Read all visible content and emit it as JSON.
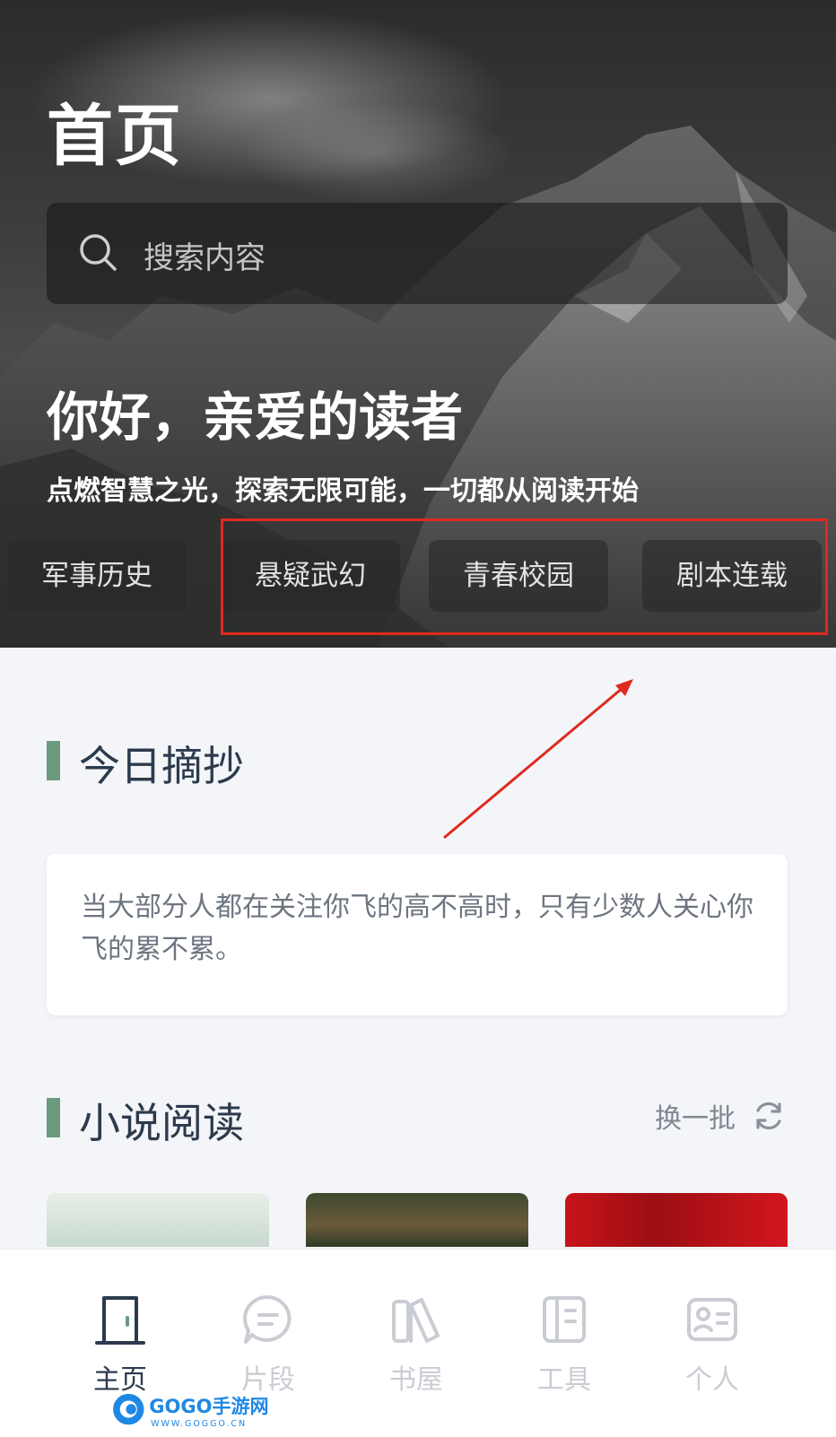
{
  "header": {
    "title": "首页",
    "search_placeholder": "搜索内容",
    "greeting": "你好，亲爱的读者",
    "subtitle": "点燃智慧之光，探索无限可能，一切都从阅读开始"
  },
  "categories": [
    {
      "label": "军事历史"
    },
    {
      "label": "悬疑武幻"
    },
    {
      "label": "青春校园"
    },
    {
      "label": "剧本连载"
    }
  ],
  "daily_quote": {
    "section_title": "今日摘抄",
    "text": "当大部分人都在关注你飞的高不高时，只有少数人关心你飞的累不累。"
  },
  "novel_section": {
    "title": "小说阅读",
    "refresh_label": "换一批"
  },
  "tabbar": {
    "items": [
      {
        "label": "主页",
        "icon": "door-icon",
        "active": true
      },
      {
        "label": "片段",
        "icon": "chat-bubble-icon",
        "active": false
      },
      {
        "label": "书屋",
        "icon": "books-icon",
        "active": false
      },
      {
        "label": "工具",
        "icon": "toolbox-icon",
        "active": false
      },
      {
        "label": "个人",
        "icon": "id-card-icon",
        "active": false
      }
    ]
  },
  "watermark": {
    "brand": "GOGO手游网",
    "url": "WWW.GOGGO.CN"
  },
  "colors": {
    "accent_bar": "#6b9a7e",
    "highlight_box": "#e0291f",
    "annotation_arrow": "#e0291f",
    "active_tab": "#2c3a4c",
    "inactive_tab": "#c9cdd3"
  }
}
